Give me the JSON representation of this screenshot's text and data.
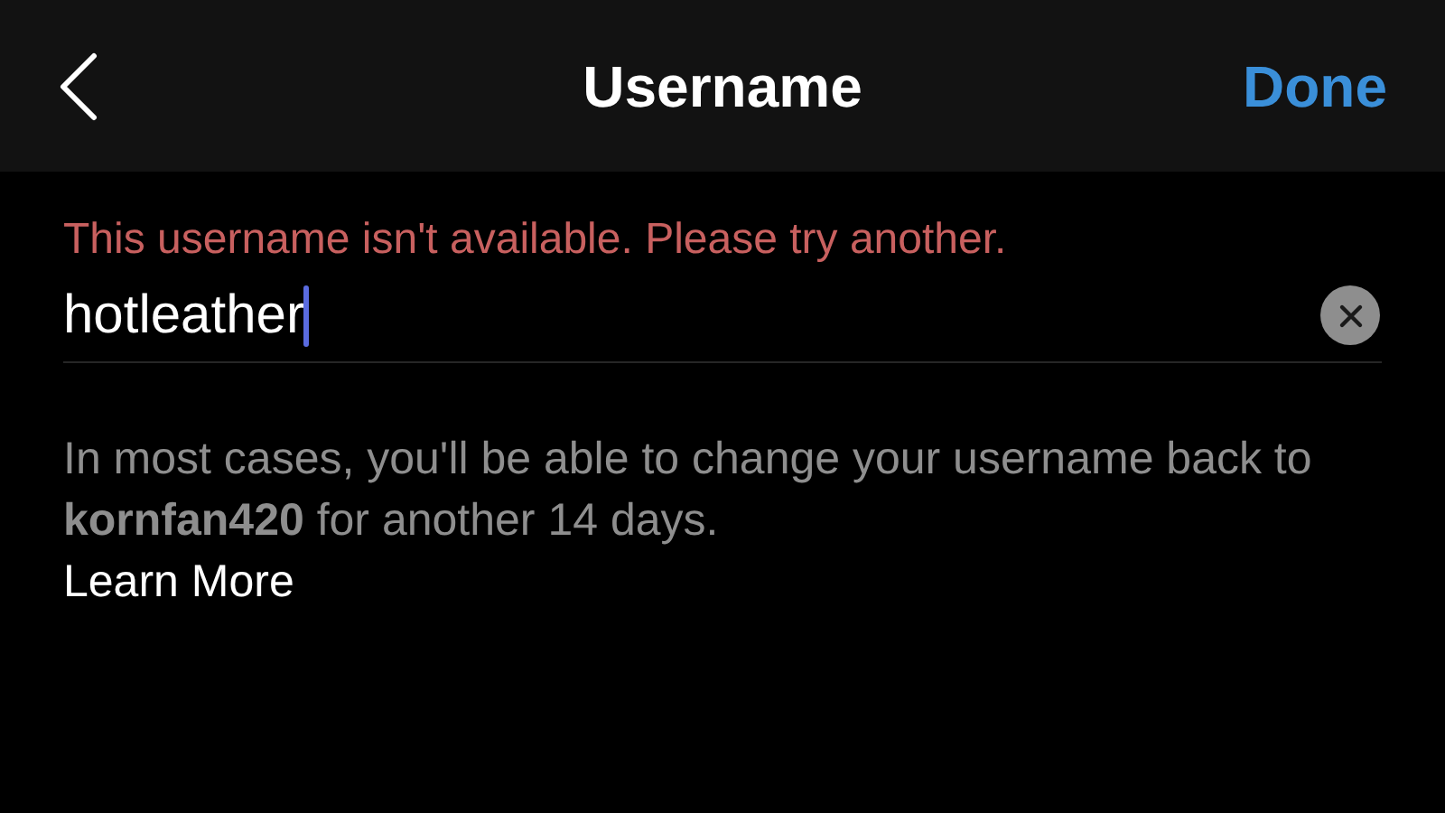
{
  "header": {
    "title": "Username",
    "done": "Done"
  },
  "error": "This username isn't available. Please try another.",
  "field": {
    "value": "hotleather",
    "focused": true
  },
  "help": {
    "text": "In most cases, you'll be able to change your username back to **kornfan420** for another 14 days.",
    "link": "Learn More"
  }
}
